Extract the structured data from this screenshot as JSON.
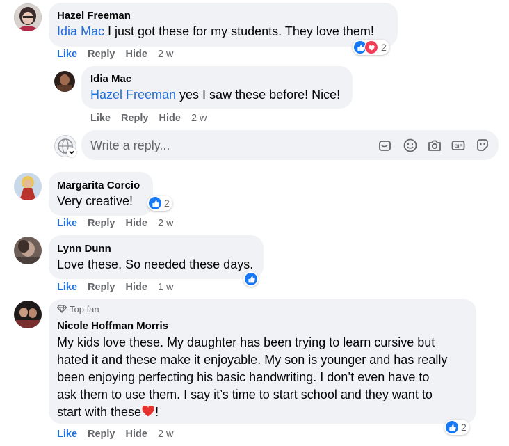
{
  "comments": [
    {
      "author": "Hazel Freeman",
      "mention": "Idia Mac",
      "text": " I just got these for my students. They love them!",
      "actions": {
        "like": "Like",
        "reply": "Reply",
        "hide": "Hide",
        "time": "2 w"
      },
      "reaction_count": "2",
      "reactions": [
        "like",
        "love"
      ]
    },
    {
      "author": "Idia Mac",
      "mention": "Hazel Freeman",
      "text": " yes I saw these before! Nice!",
      "actions": {
        "like": "Like",
        "reply": "Reply",
        "hide": "Hide",
        "time": "2 w"
      }
    },
    {
      "author": "Margarita Corcio",
      "text": "Very creative!",
      "actions": {
        "like": "Like",
        "reply": "Reply",
        "hide": "Hide",
        "time": "2 w"
      },
      "reaction_count": "2",
      "reactions": [
        "like"
      ]
    },
    {
      "author": "Lynn Dunn",
      "text": "Love these. So needed these days.",
      "actions": {
        "like": "Like",
        "reply": "Reply",
        "hide": "Hide",
        "time": "1 w"
      },
      "reactions": [
        "like"
      ]
    },
    {
      "badge": "Top fan",
      "author": "Nicole Hoffman Morris",
      "lines": [
        "My kids love these. My daughter has been trying to learn cursive but",
        "hated it and these make it enjoyable. My son is younger and has really",
        "been enjoying perfecting his basic handwriting. I don’t even have to",
        "ask them to use them. I say it’s time to start school and they want to",
        "start with these"
      ],
      "line_end": "!",
      "actions": {
        "like": "Like",
        "reply": "Reply",
        "hide": "Hide",
        "time": "2 w"
      },
      "reaction_count": "2",
      "reactions": [
        "like"
      ]
    }
  ],
  "reply_box": {
    "placeholder": "Write a reply...",
    "tools": [
      "sticker-icon",
      "emoji-icon",
      "camera-icon",
      "gif-icon",
      "avatar-sticker-icon"
    ]
  },
  "colors": {
    "bubble": "#f0f2f5",
    "mention": "#216fdb",
    "like_blue": "#1877f2",
    "love_red": "#f33e58",
    "secondary_text": "#65676b"
  }
}
